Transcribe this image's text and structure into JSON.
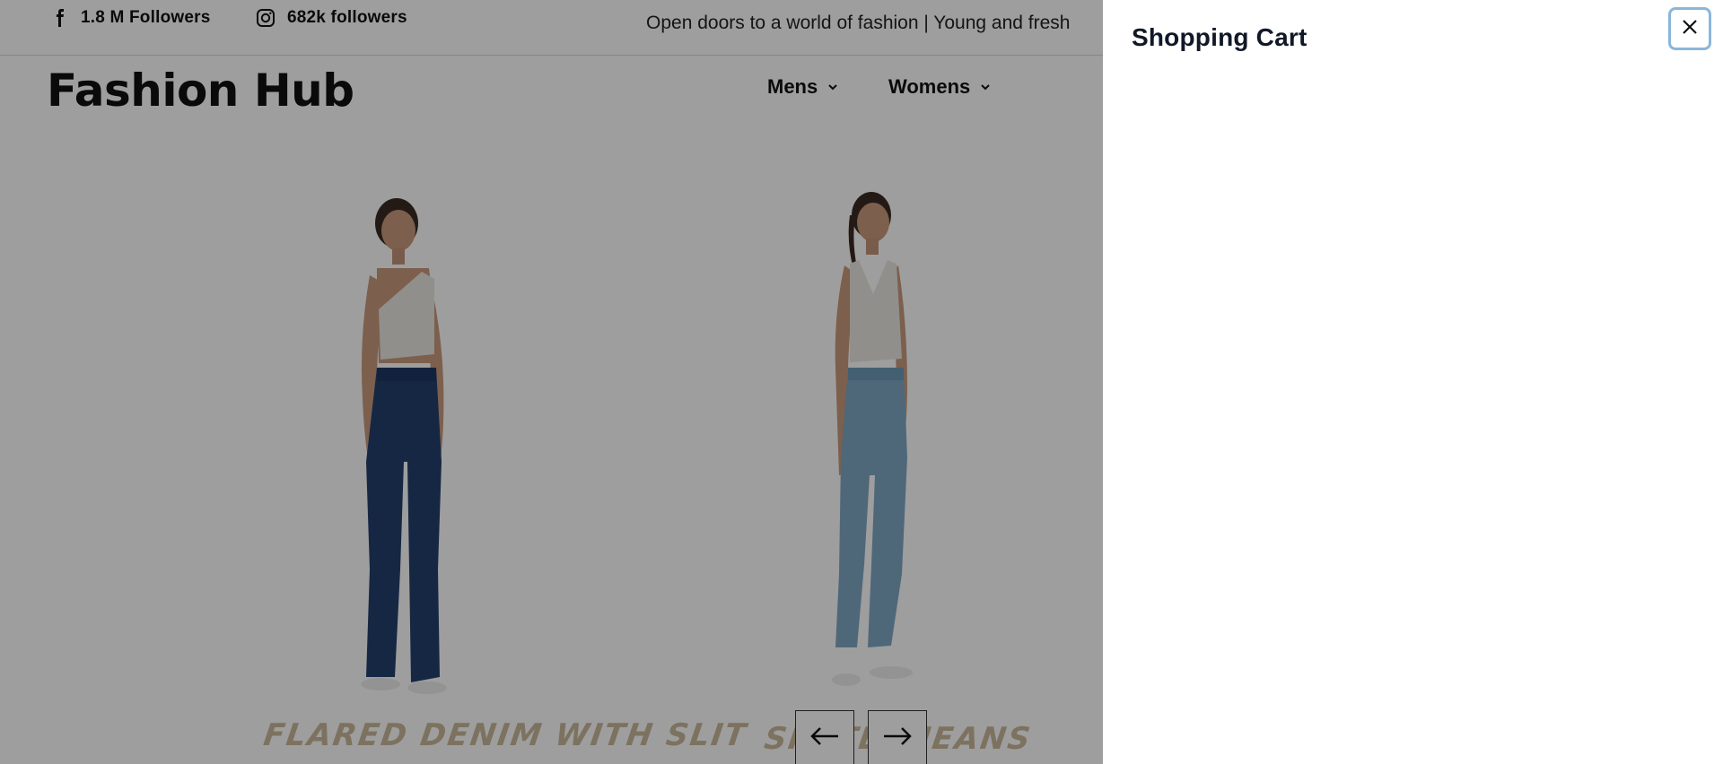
{
  "topbar": {
    "facebook": {
      "icon": "facebook-icon",
      "label": "1.8 M Followers"
    },
    "instagram": {
      "icon": "instagram-icon",
      "label": "682k followers"
    },
    "tagline": "Open doors to a world of fashion | Young and fresh"
  },
  "header": {
    "brand": "Fashion Hub",
    "nav": [
      {
        "label": "Mens",
        "icon": "chevron-down-icon"
      },
      {
        "label": "Womens",
        "icon": "chevron-down-icon"
      }
    ]
  },
  "slider": {
    "slides": [
      {
        "caption": "FLARED DENIM WITH SLIT",
        "image": "model-flared-denim"
      },
      {
        "caption": "SKATER JEANS",
        "image": "model-skater-jeans"
      }
    ],
    "prev_icon": "arrow-left-icon",
    "next_icon": "arrow-right-icon"
  },
  "cart": {
    "title": "Shopping Cart",
    "close_icon": "close-icon"
  },
  "colors": {
    "overlay": "rgba(0,0,0,0.38)",
    "close_focus_ring": "#8ab6dc",
    "caption": "#c8b99a"
  }
}
